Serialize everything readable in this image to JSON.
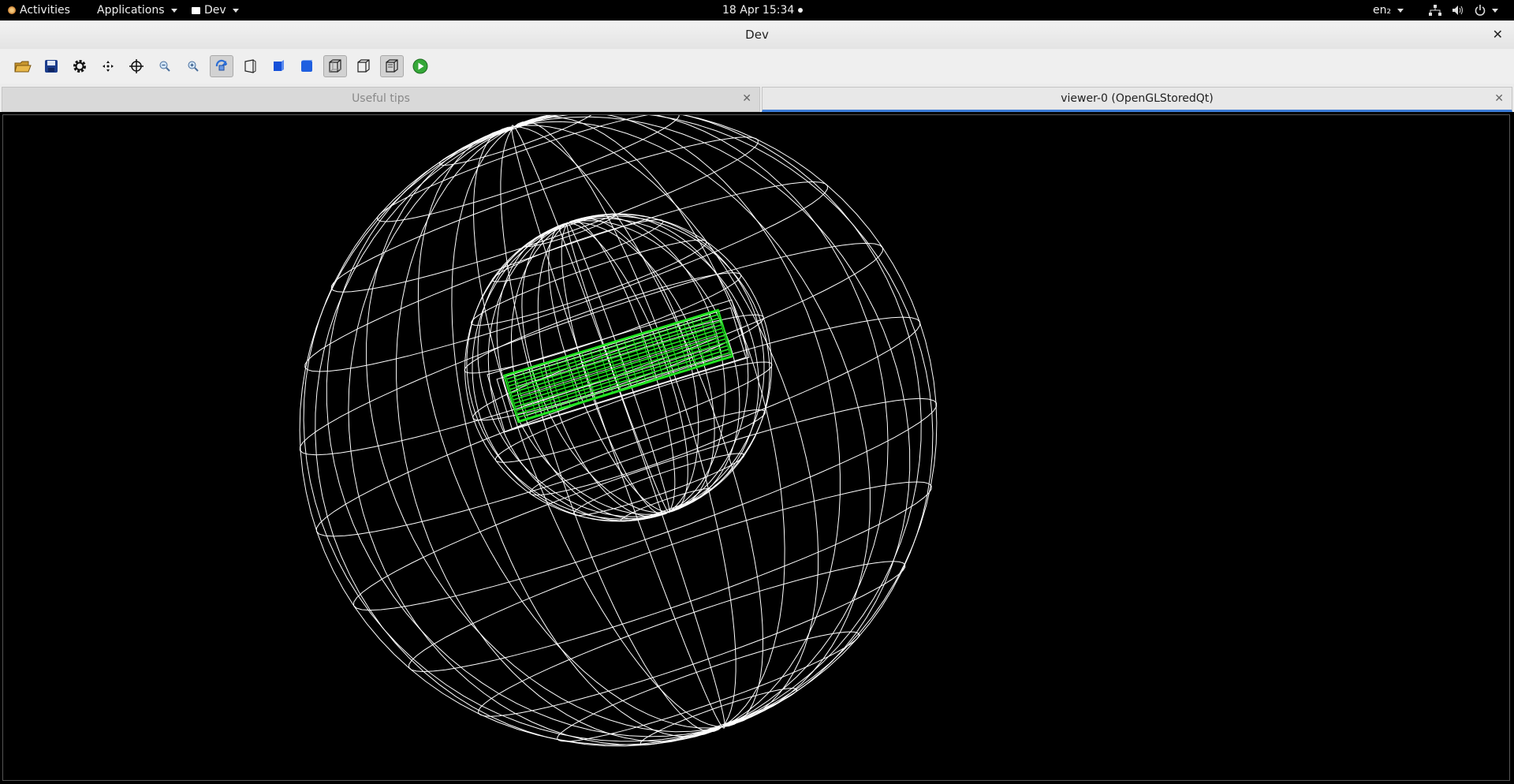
{
  "topbar": {
    "activities": "Activities",
    "applications": "Applications",
    "app_menu": "Dev",
    "datetime": "18 Apr  15:34",
    "lang": "en₂"
  },
  "window": {
    "title": "Dev",
    "close": "✕"
  },
  "toolbar": {
    "buttons": [
      {
        "name": "open-icon"
      },
      {
        "name": "save-icon"
      },
      {
        "name": "settings-icon"
      },
      {
        "name": "move-icon"
      },
      {
        "name": "pick-icon"
      },
      {
        "name": "zoom-out-icon"
      },
      {
        "name": "zoom-in-icon"
      },
      {
        "name": "rotate-icon",
        "pressed": true
      },
      {
        "name": "perspective-icon"
      },
      {
        "name": "solid-icon"
      },
      {
        "name": "solid2-icon"
      },
      {
        "name": "wireframe-icon",
        "pressed": true
      },
      {
        "name": "hidden-line-icon"
      },
      {
        "name": "hidden-line-removal-icon",
        "pressed": true
      },
      {
        "name": "run-icon"
      }
    ]
  },
  "tabs": [
    {
      "label": "Useful tips",
      "close": "✕",
      "active": false
    },
    {
      "label": "viewer-0 (OpenGLStoredQt)",
      "close": "✕",
      "active": true
    }
  ],
  "colors": {
    "wire": "#ffffff",
    "detector": "#22e622",
    "accent": "#3b7bd6"
  }
}
